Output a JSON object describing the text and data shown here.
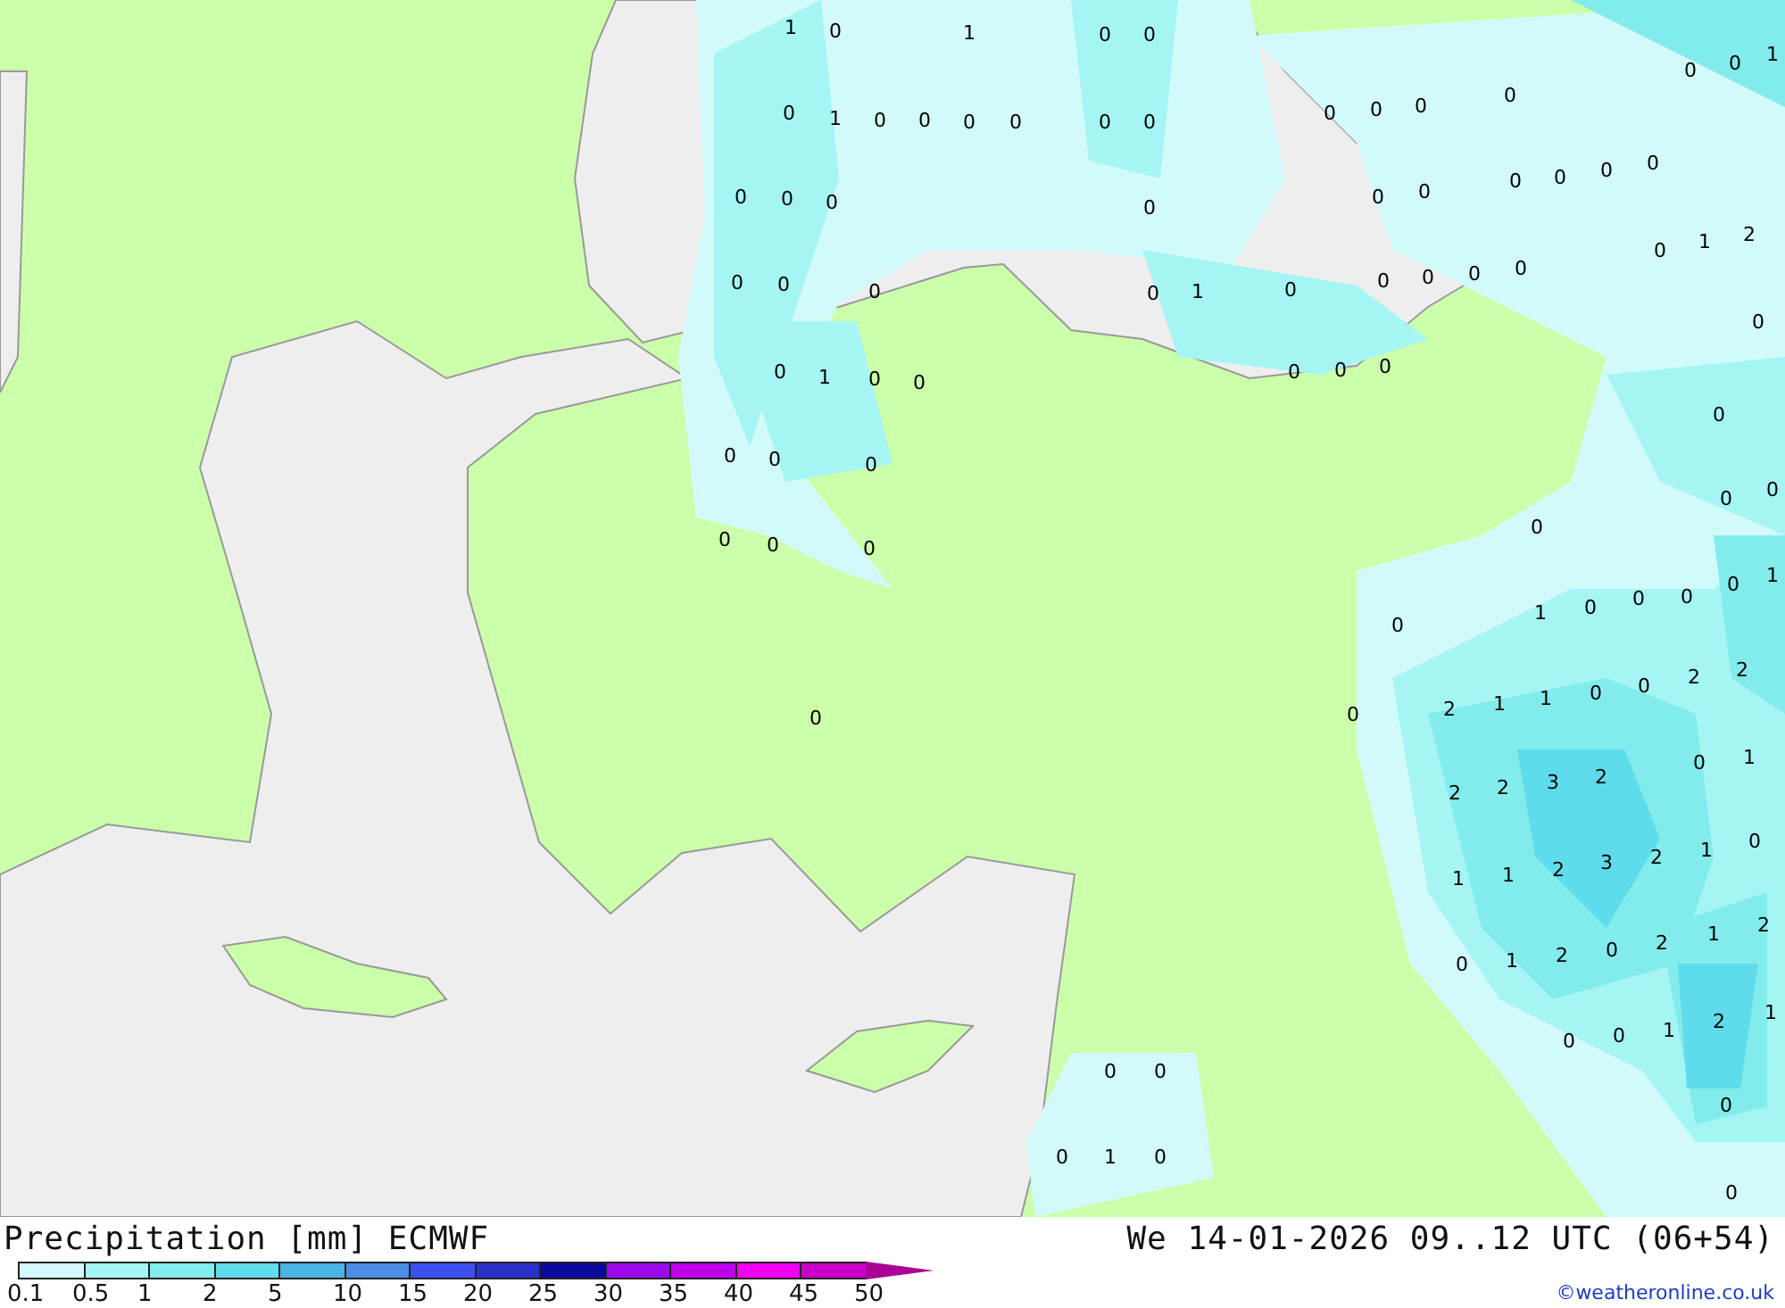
{
  "map": {
    "values": [
      "1",
      "0",
      "1",
      "0",
      "0",
      "0",
      "1",
      "0",
      "0",
      "0",
      "0",
      "0",
      "0",
      "0",
      "0",
      "0",
      "0",
      "0",
      "0",
      "1",
      "0",
      "0",
      "0",
      "0",
      "0",
      "0",
      "0",
      "0",
      "0",
      "0",
      "0",
      "0",
      "0",
      "0",
      "1",
      "0",
      "0",
      "0",
      "0",
      "0",
      "0",
      "1",
      "2",
      "0",
      "0",
      "1",
      "0",
      "0",
      "0",
      "0",
      "0",
      "0",
      "0",
      "0",
      "0",
      "0",
      "0",
      "0",
      "0",
      "0",
      "0",
      "1",
      "0",
      "0",
      "0",
      "0",
      "0",
      "1",
      "0",
      "2",
      "1",
      "1",
      "0",
      "0",
      "2",
      "2",
      "0",
      "0",
      "0",
      "1",
      "2",
      "2",
      "3",
      "2",
      "0",
      "1",
      "1",
      "2",
      "3",
      "2",
      "1",
      "0",
      "1",
      "2",
      "0",
      "2",
      "1",
      "2",
      "0",
      "0",
      "1",
      "2",
      "1",
      "0",
      "0",
      "0",
      "1",
      "0",
      "0"
    ]
  },
  "legend": {
    "title": "Precipitation [mm] ECMWF",
    "valid_time": "We 14-01-2026 09..12 UTC (06+54)",
    "credit": "©weatheronline.co.uk",
    "scale": [
      {
        "label": "0.1",
        "color": "#d2fafa"
      },
      {
        "label": "0.5",
        "color": "#a5f5f5"
      },
      {
        "label": "1",
        "color": "#82ebeb"
      },
      {
        "label": "2",
        "color": "#5fdceb"
      },
      {
        "label": "5",
        "color": "#4bb4e6"
      },
      {
        "label": "10",
        "color": "#4b8ce6"
      },
      {
        "label": "15",
        "color": "#3c50f0"
      },
      {
        "label": "20",
        "color": "#2832c8"
      },
      {
        "label": "25",
        "color": "#0a0a9b"
      },
      {
        "label": "30",
        "color": "#9b0aeb"
      },
      {
        "label": "35",
        "color": "#be00eb"
      },
      {
        "label": "40",
        "color": "#f000f0"
      },
      {
        "label": "45",
        "color": "#c800c8"
      },
      {
        "label": "50",
        "color": "#aa0096"
      }
    ]
  }
}
